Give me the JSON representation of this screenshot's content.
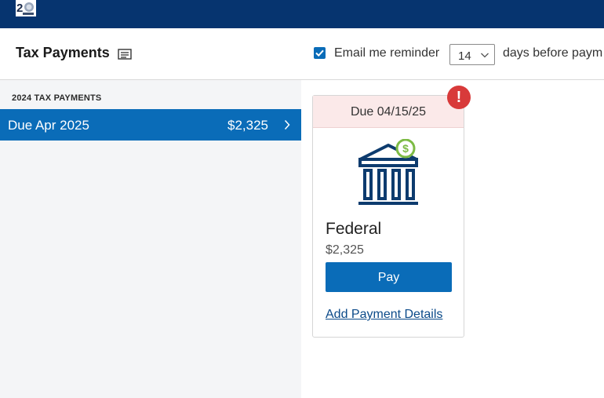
{
  "header": {
    "title": "Tax Payments",
    "email_reminder_label": "Email me reminder",
    "email_reminder_checked": true,
    "days_value": "14",
    "days_after_label": "days before paym"
  },
  "sidebar": {
    "section_heading": "2024 TAX PAYMENTS",
    "items": [
      {
        "label": "Due Apr 2025",
        "amount": "$2,325"
      }
    ]
  },
  "card": {
    "due": "Due 04/15/25",
    "alert": "!",
    "name": "Federal",
    "amount": "$2,325",
    "pay_label": "Pay",
    "add_details_label": "Add Payment Details"
  },
  "colors": {
    "topbar": "#06346f",
    "accent": "#0a6cb8",
    "due_bg": "#fbe9e9",
    "alert": "#d83a3a",
    "money_green": "#7dbb45"
  },
  "icons": {
    "logo": "anniversary-logo",
    "title": "notes-icon",
    "chevron": "chevron-right-icon",
    "select": "chevron-down-icon",
    "bank": "bank-building-icon"
  }
}
